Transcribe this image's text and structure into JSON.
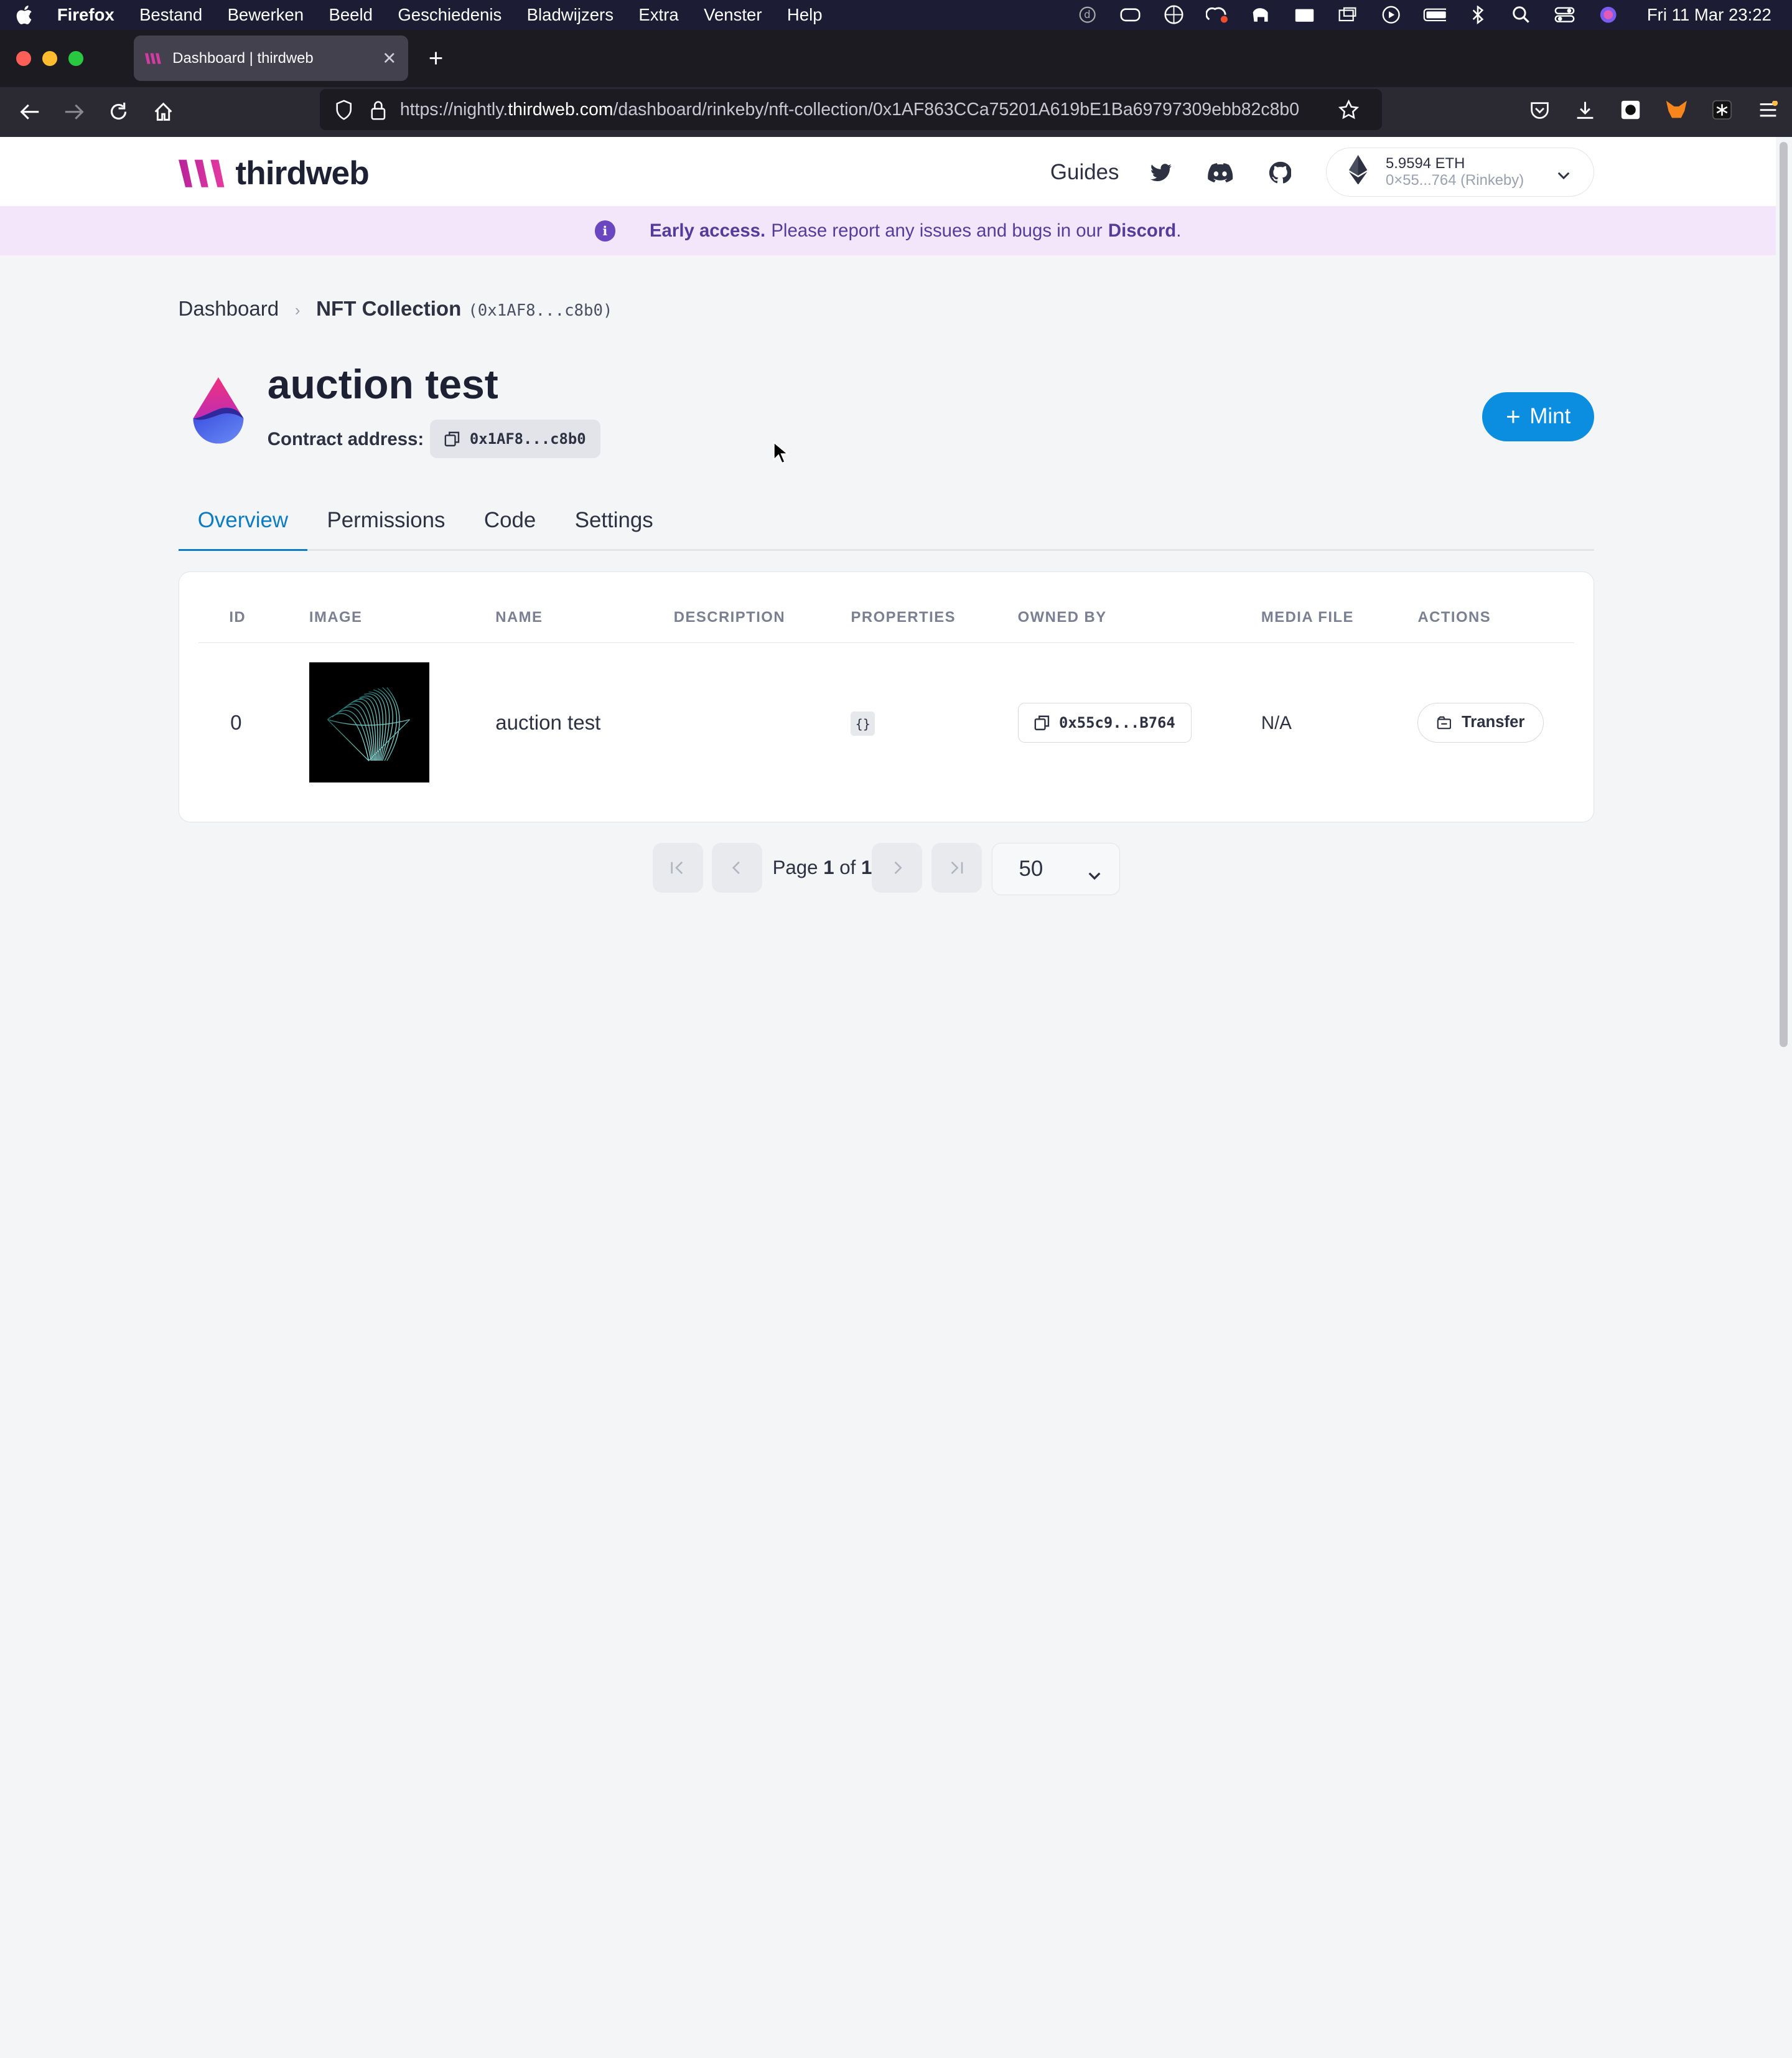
{
  "menubar": {
    "app": "Firefox",
    "items": [
      "Bestand",
      "Bewerken",
      "Beeld",
      "Geschiedenis",
      "Bladwijzers",
      "Extra",
      "Venster",
      "Help"
    ],
    "clock": "Fri 11 Mar  23:22"
  },
  "browser": {
    "tab_title": "Dashboard | thirdweb",
    "url_prefix": "https://nightly.",
    "url_domain": "thirdweb.com",
    "url_path": "/dashboard/rinkeby/nft-collection/0x1AF863CCa75201A619bE1Ba69797309ebb82c8b0"
  },
  "site": {
    "logo_text": "thirdweb",
    "nav_guides": "Guides",
    "wallet_balance": "5.9594 ETH",
    "wallet_address": "0×55...764 (Rinkeby)"
  },
  "banner": {
    "strong": "Early access.",
    "text": "Please report any issues and bugs in our",
    "link": "Discord",
    "end": "."
  },
  "breadcrumb": {
    "root": "Dashboard",
    "current": "NFT Collection",
    "address": "(0x1AF8...c8b0)"
  },
  "contract": {
    "name": "auction test",
    "address_label": "Contract address:",
    "address_short": "0x1AF8...c8b0",
    "mint_label": "Mint"
  },
  "tabs": [
    "Overview",
    "Permissions",
    "Code",
    "Settings"
  ],
  "table": {
    "headers": [
      "ID",
      "IMAGE",
      "NAME",
      "DESCRIPTION",
      "PROPERTIES",
      "OWNED BY",
      "MEDIA FILE",
      "ACTIONS"
    ],
    "row": {
      "id": "0",
      "name": "auction test",
      "properties": "{}",
      "owner": "0x55c9...B764",
      "media": "N/A",
      "action": "Transfer"
    }
  },
  "pagination": {
    "page_word": "Page",
    "current": "1",
    "of_word": "of",
    "total": "1",
    "page_size": "50"
  },
  "colors": {
    "accent": "#0b8ee0",
    "banner_bg": "#f3e6fa",
    "banner_text": "#553c9a"
  }
}
